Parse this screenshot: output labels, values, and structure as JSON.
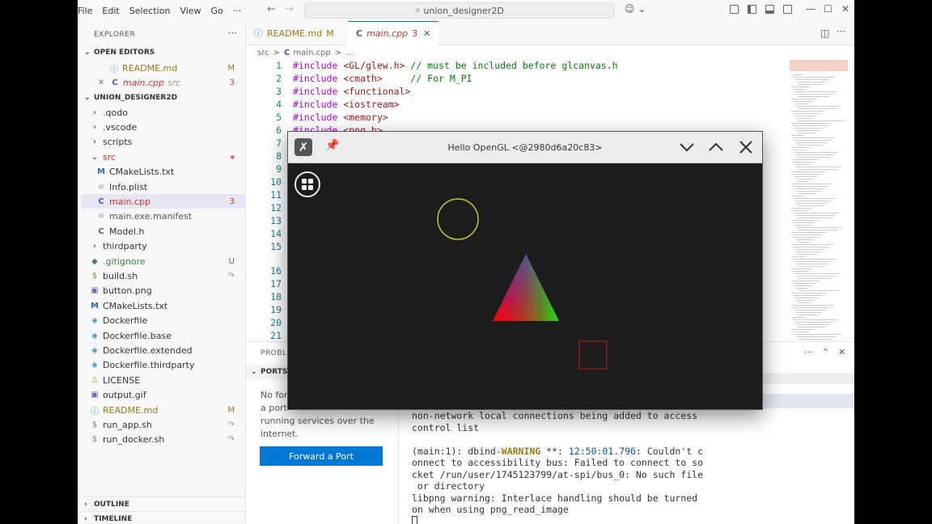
{
  "titlebar": {
    "menus": [
      "File",
      "Edit",
      "Selection",
      "View",
      "Go",
      "···"
    ],
    "command_center": "union_designer2D"
  },
  "sidebar": {
    "title": "EXPLORER",
    "open_editors_label": "OPEN EDITORS",
    "open_editors": [
      {
        "name": "README.md",
        "badge": "M"
      },
      {
        "name": "main.cpp",
        "folder": "src",
        "badge": "3"
      }
    ],
    "project_label": "UNION_DESIGNER2D",
    "tree": [
      {
        "name": ".qodo",
        "type": "folder",
        "badge": ""
      },
      {
        "name": ".vscode",
        "type": "folder",
        "badge": ""
      },
      {
        "name": "scripts",
        "type": "folder",
        "badge": ""
      },
      {
        "name": "src",
        "type": "folder-open",
        "badge": "●"
      },
      {
        "name": "CMakeLists.txt",
        "type": "cmake",
        "badge": ""
      },
      {
        "name": "Info.plist",
        "type": "plist",
        "badge": ""
      },
      {
        "name": "main.cpp",
        "type": "c",
        "badge": "3"
      },
      {
        "name": "main.exe.manifest",
        "type": "plist",
        "badge": ""
      },
      {
        "name": "Model.h",
        "type": "c",
        "badge": ""
      },
      {
        "name": "thirdparty",
        "type": "folder",
        "badge": ""
      },
      {
        "name": ".gitignore",
        "type": "git",
        "badge": "U"
      },
      {
        "name": "build.sh",
        "type": "sh",
        "badge": "↷"
      },
      {
        "name": "button.png",
        "type": "img",
        "badge": ""
      },
      {
        "name": "CMakeLists.txt",
        "type": "cmake",
        "badge": ""
      },
      {
        "name": "Dockerfile",
        "type": "docker",
        "badge": ""
      },
      {
        "name": "Dockerfile.base",
        "type": "docker",
        "badge": ""
      },
      {
        "name": "Dockerfile.extended",
        "type": "docker",
        "badge": ""
      },
      {
        "name": "Dockerfile.thirdparty",
        "type": "docker",
        "badge": ""
      },
      {
        "name": "LICENSE",
        "type": "lic",
        "badge": ""
      },
      {
        "name": "output.gif",
        "type": "img",
        "badge": ""
      },
      {
        "name": "README.md",
        "type": "md",
        "badge": "M"
      },
      {
        "name": "run_app.sh",
        "type": "sh",
        "badge": "↷"
      },
      {
        "name": "run_docker.sh",
        "type": "sh",
        "badge": "↷"
      }
    ],
    "outline_label": "OUTLINE",
    "timeline_label": "TIMELINE"
  },
  "tabs": [
    {
      "name": "README.md",
      "badge": "M"
    },
    {
      "name": "main.cpp",
      "badge": "3"
    }
  ],
  "breadcrumbs": {
    "folder": "src",
    "sep": ">",
    "file": "main.cpp",
    "more": "..."
  },
  "code": {
    "line_numbers": [
      "1",
      "2",
      "3",
      "4",
      "5",
      "6",
      "7",
      "8",
      "9",
      "10",
      "11",
      "12",
      "13",
      "14",
      "15",
      "16",
      "17",
      "18",
      "19",
      "20",
      "21"
    ],
    "lines": [
      {
        "inc": "#include",
        "hdr": " <GL/glew.h>",
        "cmt": " // must be included before glcanvas.h"
      },
      {
        "inc": "#include",
        "hdr": " <cmath>",
        "cmt": "     // For M_PI"
      },
      {
        "inc": "#include",
        "hdr": " <functional>",
        "cmt": ""
      },
      {
        "inc": "#include",
        "hdr": " <iostream>",
        "cmt": ""
      },
      {
        "inc": "#include",
        "hdr": " <memory>",
        "cmt": ""
      },
      {
        "inc": "#include",
        "hdr": " <png.h>",
        "cmt": ""
      }
    ]
  },
  "panel": {
    "problems_label": "PROBLE",
    "ports_label": "PORTS",
    "ports_text_lines": [
      "No for",
      "a port",
      "running services over the",
      "internet."
    ],
    "forward_button": "Forward a Port",
    "terminal_lines": [
      {
        "text": "non-network local connections being added to access"
      },
      {
        "text": "control list"
      },
      {
        "text": ""
      },
      {
        "pre": "(main:1): dbind-",
        "warn": "WARNING",
        "mid": " **: ",
        "ts": "12:50:01.796",
        "post": ": Couldn't c"
      },
      {
        "text": "onnect to accessibility bus: Failed to connect to so"
      },
      {
        "text": "cket /run/user/1745123799/at-spi/bus_0: No such file"
      },
      {
        "text": " or directory"
      },
      {
        "text": "libpng warning: Interlace handling should be turned"
      },
      {
        "text": "on when using png_read_image"
      }
    ]
  },
  "gl_window": {
    "title": "Hello OpenGL <@2980d6a20c83>"
  },
  "colors": {
    "accent": "#0078d4",
    "circle": "#c8c832",
    "square": "#8a1a1a"
  }
}
